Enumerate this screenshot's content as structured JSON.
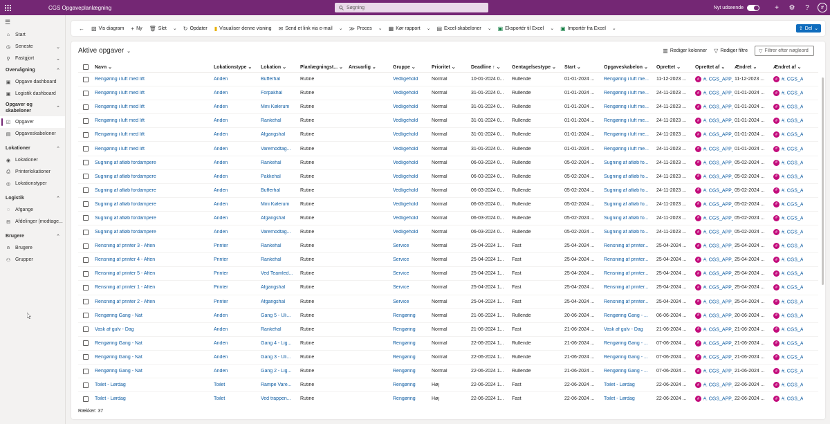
{
  "topbar": {
    "app_title": "CGS Opgaveplanlægning",
    "search_placeholder": "Søgning",
    "new_look_label": "Nyt udseende",
    "avatar_initial": "#"
  },
  "sidebar": {
    "items_top": [
      {
        "label": "Start",
        "icon": "home-icon"
      },
      {
        "label": "Seneste",
        "icon": "clock-icon",
        "chev": "⌄"
      },
      {
        "label": "Fastgjort",
        "icon": "pin-icon",
        "chev": "⌄"
      }
    ],
    "groups": [
      {
        "label": "Overvågning",
        "items": [
          {
            "label": "Opgave dashboard",
            "icon": "dashboard-icon"
          },
          {
            "label": "Logistik dashboard",
            "icon": "dashboard-icon"
          }
        ]
      },
      {
        "label": "Opgaver og skabeloner",
        "items": [
          {
            "label": "Opgaver",
            "icon": "tasks-icon"
          },
          {
            "label": "Opgaveskabeloner",
            "icon": "template-icon"
          }
        ]
      },
      {
        "label": "Lokationer",
        "items": [
          {
            "label": "Lokationer",
            "icon": "location-icon"
          },
          {
            "label": "Printerlokationer",
            "icon": "printer-icon"
          },
          {
            "label": "Lokationstyper",
            "icon": "location-type-icon"
          }
        ]
      },
      {
        "label": "Logistik",
        "items": [
          {
            "label": "Afgange",
            "icon": "departures-icon"
          },
          {
            "label": "Afdelinger (modtage...",
            "icon": "department-icon"
          }
        ]
      },
      {
        "label": "Brugere",
        "items": [
          {
            "label": "Brugere",
            "icon": "user-icon"
          },
          {
            "label": "Grupper",
            "icon": "group-icon"
          }
        ]
      }
    ]
  },
  "cmdbar": {
    "diagram": "Vis diagram",
    "new": "Ny",
    "delete": "Slet",
    "refresh": "Opdater",
    "visualize": "Visualiser denne visning",
    "email_link": "Send et link via e-mail",
    "flow": "Proces",
    "run_report": "Kør rapport",
    "excel_templates": "Excel-skabeloner",
    "export_excel": "Eksportér til Excel",
    "import_excel": "Importér fra Excel",
    "share": "Del"
  },
  "view": {
    "title": "Aktive opgaver",
    "edit_columns": "Rediger kolonner",
    "edit_filters": "Rediger filtre",
    "keyword_placeholder": "Filtrer efter nøgleord",
    "footer": "Rækker: 37"
  },
  "table": {
    "headers": [
      "Navn",
      "Lokationstype",
      "Lokation",
      "Planlægningst...",
      "Ansvarlig",
      "Gruppe",
      "Prioritet",
      "Deadline ↑",
      "Gentagelsestype",
      "Start",
      "Opgaveskabelon",
      "Oprettet",
      "Oprettet af",
      "Ændret",
      "Ændret af"
    ],
    "rows": [
      [
        "Rengøring i luft med lift",
        "Anden",
        "Bufferhal",
        "Rutine",
        "",
        "Vedligehold",
        "Normal",
        "10-01-2024 0...",
        "Rullende",
        "01-01-2024 ...",
        "Rengøring i luft me...",
        "11-12-2023 ...",
        "#. CGS_APP_...",
        "11-12-2023 ...",
        "#. CGS_APP_..."
      ],
      [
        "Rengøring i luft med lift",
        "Anden",
        "Forpakhal",
        "Rutine",
        "",
        "Vedligehold",
        "Normal",
        "31-01-2024 0...",
        "Rullende",
        "01-01-2024 ...",
        "Rengøring i luft me...",
        "24-11-2023 ...",
        "#. CGS_APP_...",
        "01-01-2024 ...",
        "#. CGS_APP_..."
      ],
      [
        "Rengøring i luft med lift",
        "Anden",
        "Mini Kølerum",
        "Rutine",
        "",
        "Vedligehold",
        "Normal",
        "31-01-2024 0...",
        "Rullende",
        "01-01-2024 ...",
        "Rengøring i luft me...",
        "24-11-2023 ...",
        "#. CGS_APP_...",
        "01-01-2024 ...",
        "#. CGS_APP_..."
      ],
      [
        "Rengøring i luft med lift",
        "Anden",
        "Rankehal",
        "Rutine",
        "",
        "Vedligehold",
        "Normal",
        "31-01-2024 0...",
        "Rullende",
        "01-01-2024 ...",
        "Rengøring i luft me...",
        "24-11-2023 ...",
        "#. CGS_APP_...",
        "01-01-2024 ...",
        "#. CGS_APP_..."
      ],
      [
        "Rengøring i luft med lift",
        "Anden",
        "Afgangshal",
        "Rutine",
        "",
        "Vedligehold",
        "Normal",
        "31-01-2024 0...",
        "Rullende",
        "01-01-2024 ...",
        "Rengøring i luft me...",
        "24-11-2023 ...",
        "#. CGS_APP_...",
        "01-01-2024 ...",
        "#. CGS_APP_..."
      ],
      [
        "Rengøring i luft med lift",
        "Anden",
        "Varemodtag...",
        "Rutine",
        "",
        "Vedligehold",
        "Normal",
        "31-01-2024 0...",
        "Rullende",
        "01-01-2024 ...",
        "Rengøring i luft me...",
        "24-11-2023 ...",
        "#. CGS_APP_...",
        "01-01-2024 ...",
        "#. CGS_APP_..."
      ],
      [
        "Sugning af afløb fordampere",
        "Anden",
        "Rankehal",
        "Rutine",
        "",
        "Vedligehold",
        "Normal",
        "06-03-2024 0...",
        "Rullende",
        "05-02-2024 ...",
        "Sugning af afløb fo...",
        "24-11-2023 ...",
        "#. CGS_APP_...",
        "05-02-2024 ...",
        "#. CGS_APP_..."
      ],
      [
        "Sugning af afløb fordampere",
        "Anden",
        "Pakkehal",
        "Rutine",
        "",
        "Vedligehold",
        "Normal",
        "06-03-2024 0...",
        "Rullende",
        "05-02-2024 ...",
        "Sugning af afløb fo...",
        "24-11-2023 ...",
        "#. CGS_APP_...",
        "05-02-2024 ...",
        "#. CGS_APP_..."
      ],
      [
        "Sugning af afløb fordampere",
        "Anden",
        "Bufferhal",
        "Rutine",
        "",
        "Vedligehold",
        "Normal",
        "06-03-2024 0...",
        "Rullende",
        "05-02-2024 ...",
        "Sugning af afløb fo...",
        "24-11-2023 ...",
        "#. CGS_APP_...",
        "05-02-2024 ...",
        "#. CGS_APP_..."
      ],
      [
        "Sugning af afløb fordampere",
        "Anden",
        "Mini Kølerum",
        "Rutine",
        "",
        "Vedligehold",
        "Normal",
        "06-03-2024 0...",
        "Rullende",
        "05-02-2024 ...",
        "Sugning af afløb fo...",
        "24-11-2023 ...",
        "#. CGS_APP_...",
        "05-02-2024 ...",
        "#. CGS_APP_..."
      ],
      [
        "Sugning af afløb fordampere",
        "Anden",
        "Afgangshal",
        "Rutine",
        "",
        "Vedligehold",
        "Normal",
        "06-03-2024 0...",
        "Rullende",
        "05-02-2024 ...",
        "Sugning af afløb fo...",
        "24-11-2023 ...",
        "#. CGS_APP_...",
        "05-02-2024 ...",
        "#. CGS_APP_..."
      ],
      [
        "Sugning af afløb fordampere",
        "Anden",
        "Varemodtag...",
        "Rutine",
        "",
        "Vedligehold",
        "Normal",
        "06-03-2024 0...",
        "Rullende",
        "05-02-2024 ...",
        "Sugning af afløb fo...",
        "24-11-2023 ...",
        "#. CGS_APP_...",
        "05-02-2024 ...",
        "#. CGS_APP_..."
      ],
      [
        "Rensning af printer 3 - Aften",
        "Printer",
        "Rankehal",
        "Rutine",
        "",
        "Service",
        "Normal",
        "25-04-2024 1...",
        "Fast",
        "25-04-2024 ...",
        "Rensning af printer...",
        "25-04-2024 ...",
        "#. CGS_APP_...",
        "25-04-2024 ...",
        "#. CGS_APP_..."
      ],
      [
        "Rensning af printer 4 - Aften",
        "Printer",
        "Rankehal",
        "Rutine",
        "",
        "Service",
        "Normal",
        "25-04-2024 1...",
        "Fast",
        "25-04-2024 ...",
        "Rensning af printer...",
        "25-04-2024 ...",
        "#. CGS_APP_...",
        "25-04-2024 ...",
        "#. CGS_APP_..."
      ],
      [
        "Rensning af printer 5 - Aften",
        "Printer",
        "Ved Teamled...",
        "Rutine",
        "",
        "Service",
        "Normal",
        "25-04-2024 1...",
        "Fast",
        "25-04-2024 ...",
        "Rensning af printer...",
        "25-04-2024 ...",
        "#. CGS_APP_...",
        "25-04-2024 ...",
        "#. CGS_APP_..."
      ],
      [
        "Rensning af printer 1 - Aften",
        "Printer",
        "Afgangshal",
        "Rutine",
        "",
        "Service",
        "Normal",
        "25-04-2024 1...",
        "Fast",
        "25-04-2024 ...",
        "Rensning af printer...",
        "25-04-2024 ...",
        "#. CGS_APP_...",
        "25-04-2024 ...",
        "#. CGS_APP_..."
      ],
      [
        "Rensning af printer 2 - Aften",
        "Printer",
        "Afgangshal",
        "Rutine",
        "",
        "Service",
        "Normal",
        "25-04-2024 1...",
        "Fast",
        "25-04-2024 ...",
        "Rensning af printer...",
        "25-04-2024 ...",
        "#. CGS_APP_...",
        "25-04-2024 ...",
        "#. CGS_APP_..."
      ],
      [
        "Rengøring Gang - Nat",
        "Anden",
        "Gang 5 - Uli...",
        "Rutine",
        "",
        "Rengøring",
        "Normal",
        "21-06-2024 1...",
        "Rullende",
        "20-06-2024 ...",
        "Rengøring Gang - ...",
        "06-06-2024 ...",
        "#. CGS_APP_...",
        "20-06-2024 ...",
        "#. CGS_APP_..."
      ],
      [
        "Vask af gulv - Dag",
        "Anden",
        "Rankehal",
        "Rutine",
        "",
        "Rengøring",
        "Normal",
        "21-06-2024 1...",
        "Fast",
        "21-06-2024 ...",
        "Vask af gulv - Dag",
        "21-06-2024 ...",
        "#. CGS_APP_...",
        "21-06-2024 ...",
        "#. CGS_APP_..."
      ],
      [
        "Rengøring Gang - Nat",
        "Anden",
        "Gang 4 - Lig...",
        "Rutine",
        "",
        "Rengøring",
        "Normal",
        "22-06-2024 1...",
        "Rullende",
        "21-06-2024 ...",
        "Rengøring Gang - ...",
        "07-06-2024 ...",
        "#. CGS_APP_...",
        "21-06-2024 ...",
        "#. CGS_APP_..."
      ],
      [
        "Rengøring Gang - Nat",
        "Anden",
        "Gang 3 - Uli...",
        "Rutine",
        "",
        "Rengøring",
        "Normal",
        "22-06-2024 1...",
        "Rullende",
        "21-06-2024 ...",
        "Rengøring Gang - ...",
        "07-06-2024 ...",
        "#. CGS_APP_...",
        "21-06-2024 ...",
        "#. CGS_APP_..."
      ],
      [
        "Rengøring Gang - Nat",
        "Anden",
        "Gang 2 - Lig...",
        "Rutine",
        "",
        "Rengøring",
        "Normal",
        "22-06-2024 1...",
        "Rullende",
        "21-06-2024 ...",
        "Rengøring Gang - ...",
        "07-06-2024 ...",
        "#. CGS_APP_...",
        "21-06-2024 ...",
        "#. CGS_APP_..."
      ],
      [
        "Toilet - Lørdag",
        "Toilet",
        "Rampe Vare...",
        "Rutine",
        "",
        "Rengøring",
        "Høj",
        "22-06-2024 1...",
        "Fast",
        "22-06-2024 ...",
        "Toilet - Lørdag",
        "22-06-2024 ...",
        "#. CGS_APP_...",
        "22-06-2024 ...",
        "#. CGS_APP_..."
      ],
      [
        "Toilet - Lørdag",
        "Toilet",
        "Ved trappen...",
        "Rutine",
        "",
        "Rengøring",
        "Høj",
        "22-06-2024 1...",
        "Fast",
        "22-06-2024 ...",
        "Toilet - Lørdag",
        "22-06-2024 ...",
        "#. CGS_APP_...",
        "22-06-2024 ...",
        "#. CGS_APP_..."
      ]
    ]
  }
}
